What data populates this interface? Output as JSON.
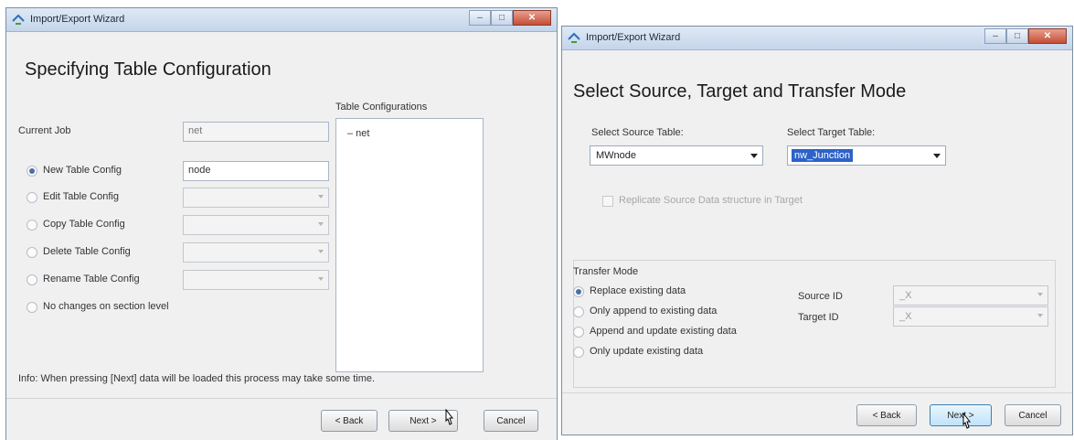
{
  "left_window": {
    "title": "Import/Export Wizard",
    "heading": "Specifying Table Configuration",
    "current_job_label": "Current Job",
    "current_job_value": "net",
    "table_configurations_label": "Table Configurations",
    "tree_item": "– net",
    "options": [
      {
        "label": "New Table Config",
        "selected": true,
        "value": "node"
      },
      {
        "label": "Edit Table Config",
        "selected": false
      },
      {
        "label": "Copy Table Config",
        "selected": false
      },
      {
        "label": "Delete Table Config",
        "selected": false
      },
      {
        "label": "Rename Table Config",
        "selected": false
      },
      {
        "label": "No changes on section level",
        "selected": false
      }
    ],
    "info_text": "Info: When pressing [Next] data will be loaded this process may take some time.",
    "buttons": {
      "back": "< Back",
      "next": "Next >",
      "cancel": "Cancel"
    }
  },
  "right_window": {
    "title": "Import/Export Wizard",
    "heading": "Select Source, Target and Transfer Mode",
    "source_label": "Select Source Table:",
    "source_value": "MWnode",
    "target_label": "Select Target Table:",
    "target_value": "nw_Junction",
    "replicate_label": "Replicate Source Data structure in Target",
    "transfer_mode_label": "Transfer Mode",
    "modes": [
      {
        "label": "Replace existing data",
        "selected": true
      },
      {
        "label": "Only append to existing data",
        "selected": false
      },
      {
        "label": "Append and update existing data",
        "selected": false
      },
      {
        "label": "Only update existing data",
        "selected": false
      }
    ],
    "source_id_label": "Source ID",
    "source_id_value": "_X",
    "target_id_label": "Target ID",
    "target_id_value": "_X",
    "buttons": {
      "back": "< Back",
      "next": "Next >",
      "cancel": "Cancel"
    }
  },
  "colors": {
    "selection": "#2d62c9",
    "radio_dot": "#4a6fa6",
    "close_button": "#c44d34"
  }
}
